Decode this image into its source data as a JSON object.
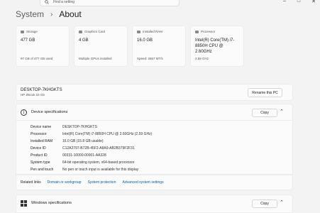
{
  "search": {
    "placeholder": "Find a setting"
  },
  "breadcrumb": {
    "parent": "System",
    "separator": "›",
    "current": "About"
  },
  "cards": [
    {
      "label": "Storage",
      "value": "477 GB",
      "sub": "97 GB of 477 GB used"
    },
    {
      "label": "Graphics Card",
      "value": "4 GB",
      "sub": "Multiple GPUs installed"
    },
    {
      "label": "Installed RAM",
      "value": "16.0 GB",
      "sub": "Speed: 2667 MT/s"
    },
    {
      "label": "Processor",
      "value": "Intel(R) Core(TM) i7-8850H CPU @ 2.60GHz",
      "sub": "2.59 GHz"
    }
  ],
  "device": {
    "name": "DESKTOP-7KHGKTS",
    "model": "HP ZBook 15 G5",
    "rename_label": "Rename this PC"
  },
  "device_specs": {
    "title": "Device specifications",
    "copy_label": "Copy",
    "rows": [
      {
        "key": "Device name",
        "value": "DESKTOP-7KHGKTS"
      },
      {
        "key": "Processor",
        "value": "Intel(R) Core(TM) i7-8850H CPU @ 2.60GHz (2.59 GHz)"
      },
      {
        "key": "Installed RAM",
        "value": "16.0 GB (15.8 GB usable)"
      },
      {
        "key": "Device ID",
        "value": "C12A2797-B72B-45F2-A8A9-AB2B379F2F31"
      },
      {
        "key": "Product ID",
        "value": "00331-10000-00001-AA328"
      },
      {
        "key": "System type",
        "value": "64-bit operating system, x64-based processor"
      },
      {
        "key": "Pen and touch",
        "value": "No pen or touch input is available for this display"
      }
    ]
  },
  "related": {
    "title": "Related links",
    "links": [
      "Domain or workgroup",
      "System protection",
      "Advanced system settings"
    ]
  },
  "windows_specs": {
    "title": "Windows specifications",
    "copy_label": "Copy"
  }
}
